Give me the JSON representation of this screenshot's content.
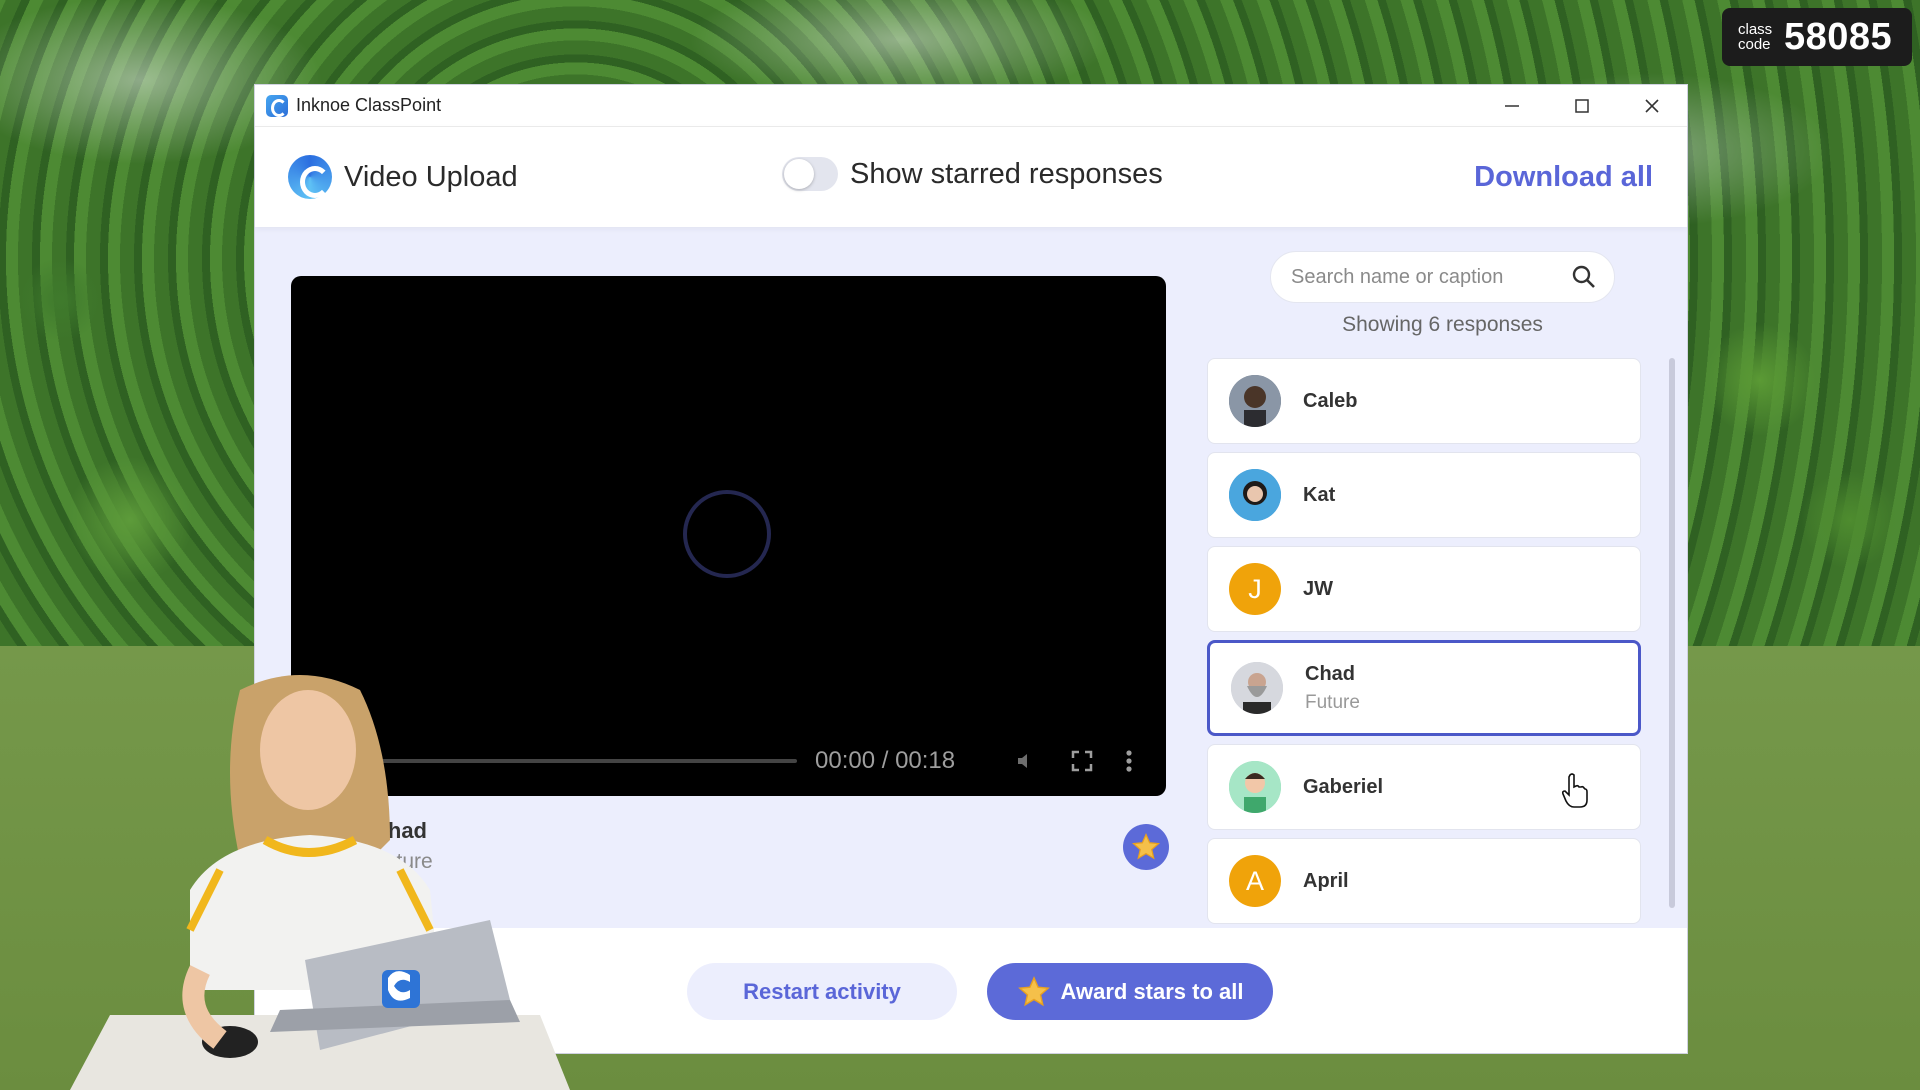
{
  "class_code": {
    "label": "class code",
    "value": "58085"
  },
  "window": {
    "title": "Inknoe ClassPoint",
    "controls": {
      "minimize": "minimize",
      "maximize": "maximize",
      "close": "close"
    }
  },
  "header": {
    "page_title": "Video Upload",
    "toggle_label": "Show starred responses",
    "toggle_on": false,
    "download_all": "Download all"
  },
  "video": {
    "time": "00:00 / 00:18",
    "progress": 0,
    "name": "Chad",
    "caption": "Future"
  },
  "search": {
    "placeholder": "Search name or caption"
  },
  "showing": "Showing 6 responses",
  "responses": [
    {
      "name": "Caleb",
      "avatar": "photo",
      "color": "#6b7a8c"
    },
    {
      "name": "Kat",
      "avatar": "photo",
      "color": "#3f9fd6"
    },
    {
      "name": "JW",
      "avatar": "J",
      "color": "#f0a30a"
    },
    {
      "name": "Chad",
      "caption": "Future",
      "avatar": "photo",
      "color": "#c8ccd6",
      "selected": true
    },
    {
      "name": "Gaberiel",
      "avatar": "photo",
      "color": "#8fd9b4"
    },
    {
      "name": "April",
      "avatar": "A",
      "color": "#f0a30a"
    }
  ],
  "footer": {
    "restart": "Restart activity",
    "award": "Award stars to all"
  },
  "colors": {
    "accent": "#5c6ad8",
    "panel_bg": "#eceefd",
    "star": "#f5c04a"
  }
}
